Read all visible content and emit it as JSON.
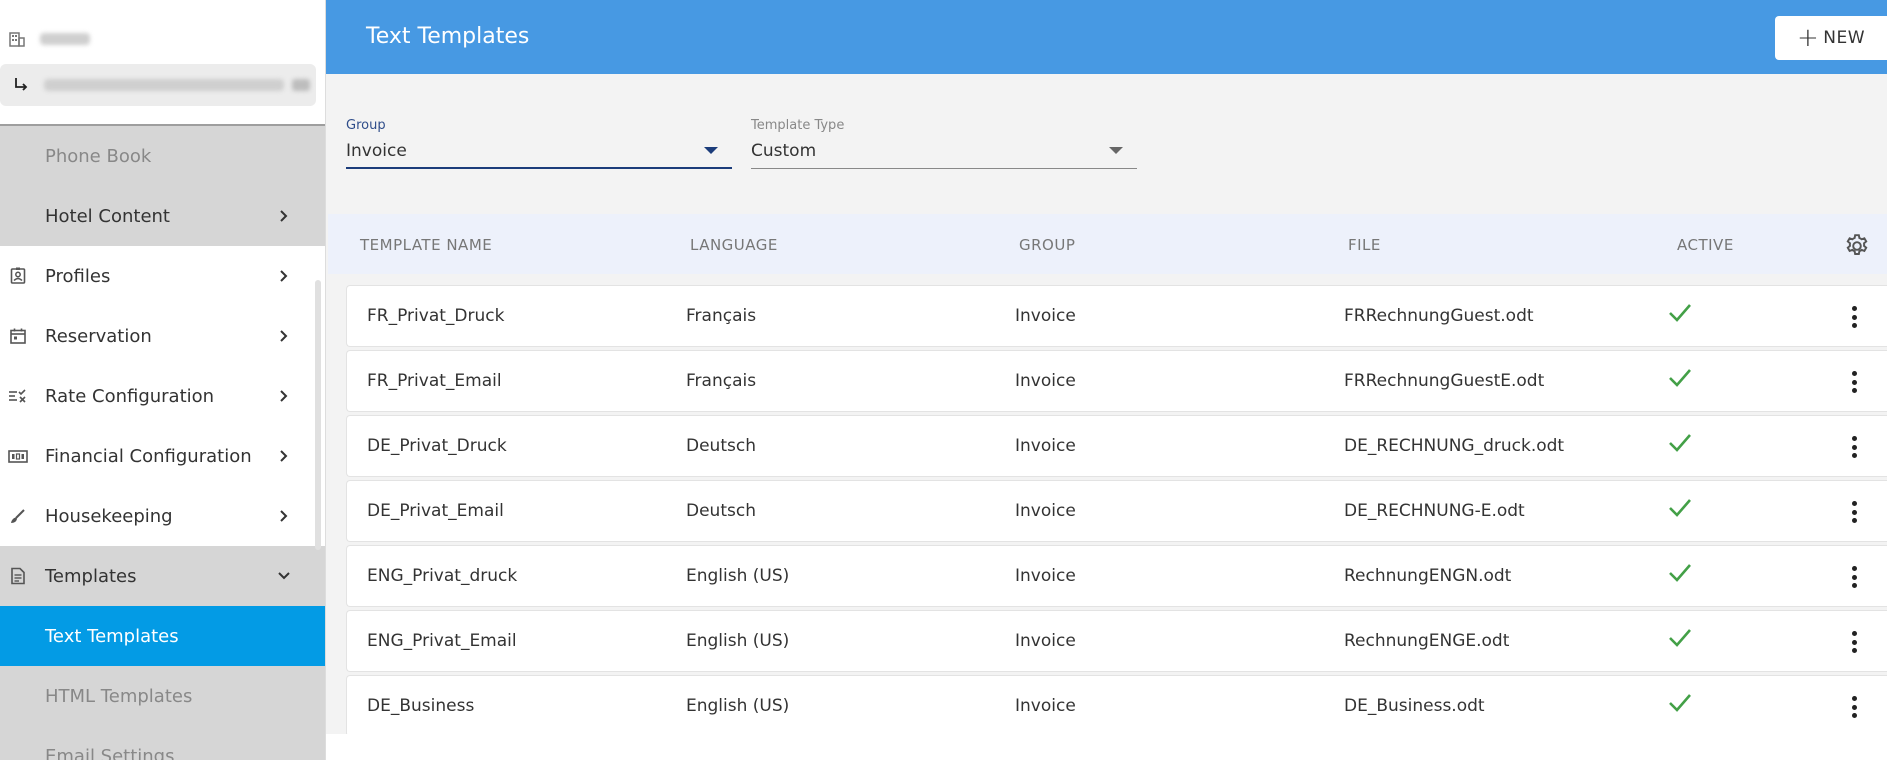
{
  "sidebar": {
    "nav": [
      {
        "label": "Phone Book",
        "icon": "",
        "has_chevron": false,
        "state": "grey-dim"
      },
      {
        "label": "Hotel Content",
        "icon": "",
        "has_chevron": true,
        "state": "grey"
      },
      {
        "label": "Profiles",
        "icon": "profile-badge-icon",
        "has_chevron": true,
        "state": "normal"
      },
      {
        "label": "Reservation",
        "icon": "calendar-icon",
        "has_chevron": true,
        "state": "normal"
      },
      {
        "label": "Rate Configuration",
        "icon": "rate-list-icon",
        "has_chevron": true,
        "state": "normal"
      },
      {
        "label": "Financial Configuration",
        "icon": "money-icon",
        "has_chevron": true,
        "state": "normal"
      },
      {
        "label": "Housekeeping",
        "icon": "brush-icon",
        "has_chevron": true,
        "state": "normal"
      },
      {
        "label": "Templates",
        "icon": "document-icon",
        "has_chevron": true,
        "state": "expanded"
      },
      {
        "label": "Text Templates",
        "icon": "",
        "has_chevron": false,
        "state": "active"
      },
      {
        "label": "HTML Templates",
        "icon": "",
        "has_chevron": false,
        "state": "grey-dim"
      },
      {
        "label": "Email Settings",
        "icon": "",
        "has_chevron": false,
        "state": "grey-dim"
      }
    ]
  },
  "header": {
    "title": "Text Templates",
    "new_button": "NEW"
  },
  "filters": {
    "group": {
      "label": "Group",
      "value": "Invoice"
    },
    "template_type": {
      "label": "Template Type",
      "value": "Custom"
    }
  },
  "table": {
    "headers": {
      "name": "TEMPLATE NAME",
      "language": "LANGUAGE",
      "group": "GROUP",
      "file": "FILE",
      "active": "ACTIVE"
    },
    "rows": [
      {
        "name": "FR_Privat_Druck",
        "language": "Français",
        "group": "Invoice",
        "file": "FRRechnungGuest.odt",
        "active": true
      },
      {
        "name": "FR_Privat_Email",
        "language": "Français",
        "group": "Invoice",
        "file": "FRRechnungGuestE.odt",
        "active": true
      },
      {
        "name": "DE_Privat_Druck",
        "language": "Deutsch",
        "group": "Invoice",
        "file": "DE_RECHNUNG_druck.odt",
        "active": true
      },
      {
        "name": "DE_Privat_Email",
        "language": "Deutsch",
        "group": "Invoice",
        "file": "DE_RECHNUNG-E.odt",
        "active": true
      },
      {
        "name": "ENG_Privat_druck",
        "language": "English (US)",
        "group": "Invoice",
        "file": "RechnungENGN.odt",
        "active": true
      },
      {
        "name": "ENG_Privat_Email",
        "language": "English (US)",
        "group": "Invoice",
        "file": "RechnungENGE.odt",
        "active": true
      },
      {
        "name": "DE_Business",
        "language": "English (US)",
        "group": "Invoice",
        "file": "DE_Business.odt",
        "active": true
      }
    ]
  },
  "colors": {
    "header_bg": "#4799e3",
    "active_nav_bg": "#039be5",
    "check_green": "#43a047",
    "table_header_bg": "#edf1fb"
  }
}
